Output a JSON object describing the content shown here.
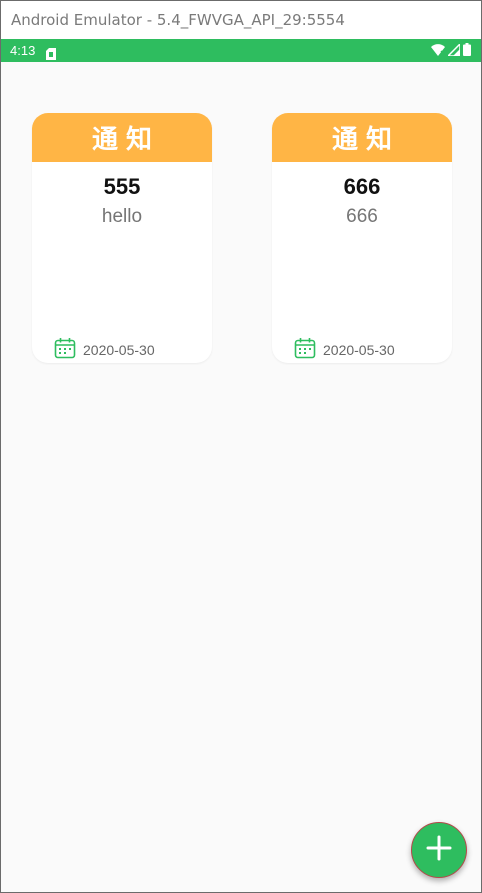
{
  "window": {
    "title": "Android Emulator - 5.4_FWVGA_API_29:5554"
  },
  "statusbar": {
    "time": "4:13",
    "bg_color": "#2ebd5f",
    "icons": [
      "sim-card-icon",
      "wifi-icon",
      "signal-icon",
      "battery-icon"
    ]
  },
  "cards": [
    {
      "header": "通知",
      "title": "555",
      "body": "hello",
      "date": "2020-05-30"
    },
    {
      "header": "通知",
      "title": "666",
      "body": "666",
      "date": "2020-05-30"
    }
  ],
  "colors": {
    "header": "#ffb545",
    "accent": "#2ebd5f"
  },
  "fab": {
    "icon": "plus-icon"
  }
}
